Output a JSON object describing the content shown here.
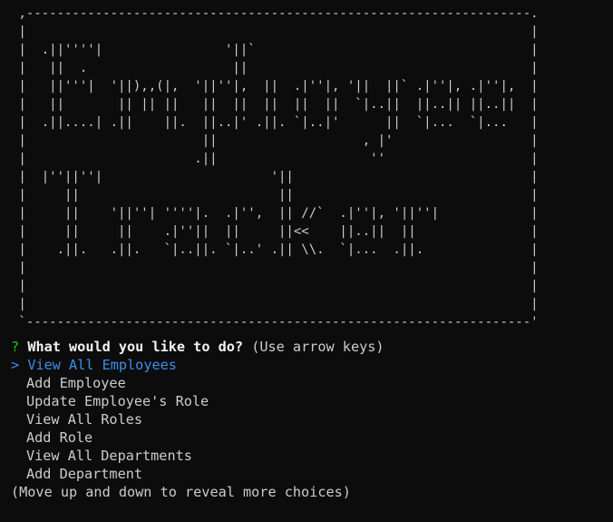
{
  "banner": {
    "lines": [
      " ,------------------------------------------------------------------.",
      " |                                                                  |",
      " |  .||''''|                '||`                                    |",
      " |   ||  .                   ||                                     |",
      " |   ||'''|  '||),,(|,  '||''|,  ||  .|''|, '||  ||` .|''|, .|''|,  |",
      " |   ||       || || ||   ||  ||  ||  ||  ||  `|..||  ||..|| ||..||  |",
      " |  .||....| .||    ||.  ||..|' .||. `|..|'      ||  `|...  `|...   |",
      " |                       ||                   , |'                  |",
      " |                      .||                    ''                   |",
      " |  |''||''|                      '||                               |",
      " |     ||                          ||                               |",
      " |     ||    '||''| ''''|.  .|'',  || //`  .|''|, '||''|            |",
      " |     ||     ||    .|''||  ||     ||<<    ||..||  ||               |",
      " |    .||.   .||.   `|..||. `|..' .|| \\\\.  `|...  .||.              |",
      " |                                                                  |",
      " |                                                                  |",
      " |                                                                  |",
      " `------------------------------------------------------------------'"
    ]
  },
  "prompt": {
    "marker": "?",
    "question": "What would you like to do?",
    "hint": "(Use arrow keys)"
  },
  "menu": {
    "pointer": ">",
    "selected": "View All Employees",
    "items": [
      "Add Employee",
      "Update Employee's Role",
      "View All Roles",
      "Add Role",
      "View All Departments",
      "Add Department"
    ],
    "footer": "(Move up and down to reveal more choices)"
  },
  "colors": {
    "background": "#0c0c0c",
    "text": "#cccccc",
    "question_mark": "#16c60c",
    "selected": "#3b8eea"
  }
}
